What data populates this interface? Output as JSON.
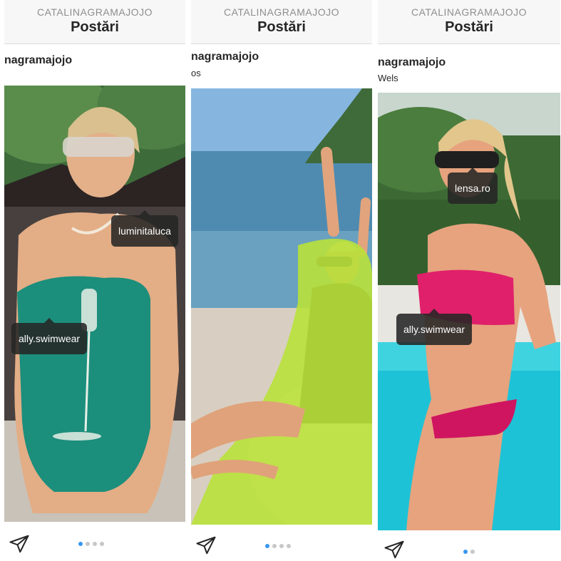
{
  "panels": [
    {
      "header": {
        "account": "CATALINAGRAMAJOJO",
        "title": "Postări"
      },
      "post": {
        "username": "nagramajojo",
        "location": ""
      },
      "tags": [
        "luminitaluca",
        "ally.swimwear"
      ],
      "icons": {
        "share": "paper-plane-icon"
      },
      "carousel": {
        "count": 4,
        "active_index": 0
      }
    },
    {
      "header": {
        "account": "CATALINAGRAMAJOJO",
        "title": "Postări"
      },
      "post": {
        "username": "nagramajojo",
        "location": "os"
      },
      "tags": [],
      "icons": {
        "share": "paper-plane-icon"
      },
      "carousel": {
        "count": 4,
        "active_index": 0
      }
    },
    {
      "header": {
        "account": "CATALINAGRAMAJOJO",
        "title": "Postări"
      },
      "post": {
        "username": "nagramajojo",
        "location": "Wels"
      },
      "tags": [
        "lensa.ro",
        "ally.swimwear"
      ],
      "icons": {
        "share": "paper-plane-icon"
      },
      "carousel": {
        "count": 2,
        "active_index": 0
      }
    }
  ],
  "colors": {
    "active_dot": "#3897f0",
    "inactive_dot": "#c7c7c7",
    "tag_bg": "#262626"
  }
}
